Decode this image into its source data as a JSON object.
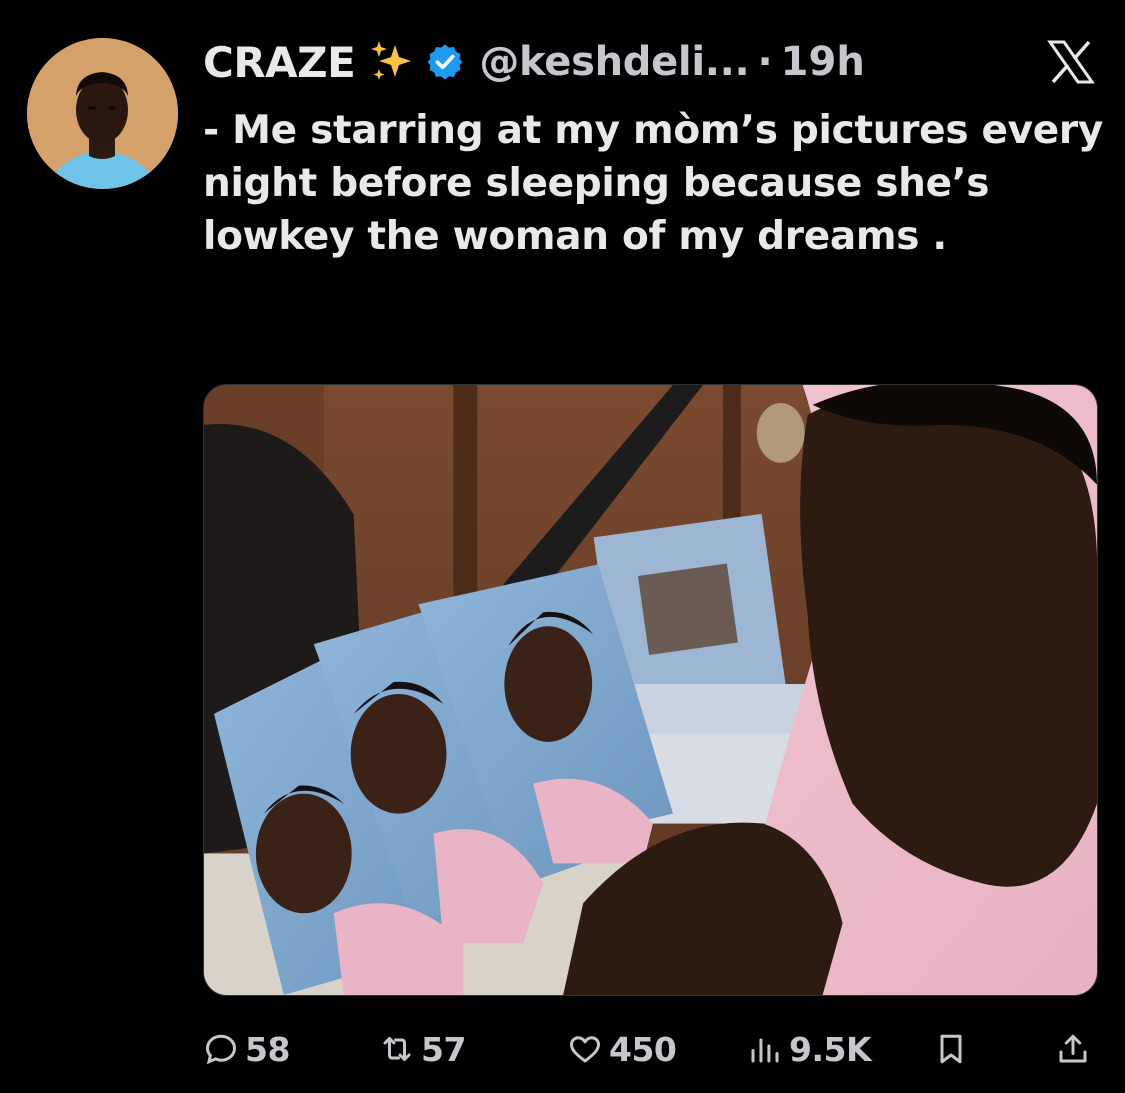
{
  "tweet": {
    "display_name": "CRAZE",
    "handle": "@keshdeli...",
    "separator": "·",
    "time": "19h",
    "text": "- Me starring at my mòm’s pictures every night before sleeping because she’s lowkey the woman of my dreams .",
    "verified": true
  },
  "icons": {
    "name_emoji": "sparkles-icon",
    "badge": "verified-badge-icon",
    "brand": "x-logo-icon"
  },
  "actions": {
    "replies": "58",
    "reposts": "57",
    "likes": "450",
    "views": "9.5K"
  },
  "colors": {
    "background": "#000000",
    "text": "#e7e9ea",
    "muted": "#c4c8cc",
    "verified": "#1d9bf0",
    "sparkle": "#f6c342"
  }
}
